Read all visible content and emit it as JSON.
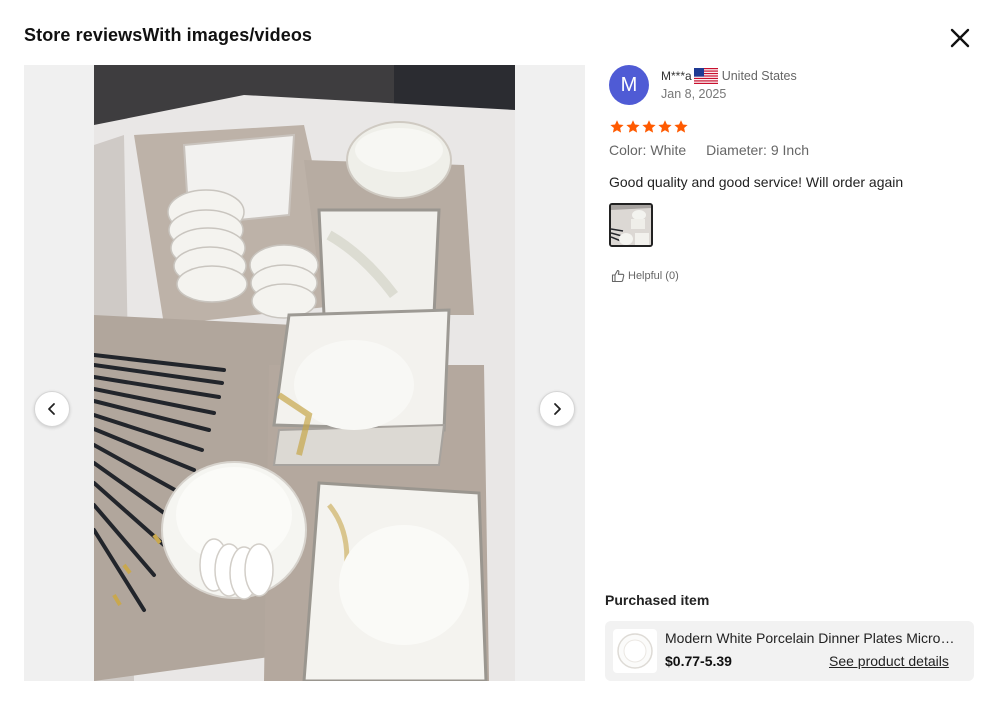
{
  "header": {
    "title": "Store reviewsWith images/videos",
    "close_icon": "close-icon"
  },
  "gallery": {
    "prev_icon": "chevron-left-icon",
    "next_icon": "chevron-right-icon",
    "photo_icon": "review-photo-dinnerware"
  },
  "review": {
    "avatar_letter": "M",
    "avatar_color": "#4f5bd5",
    "username": "M***a",
    "flag_icon": "us-flag-icon",
    "country": "United States",
    "date": "Jan 8, 2025",
    "rating": 5,
    "star_color": "#ff5a00",
    "attributes": [
      {
        "name": "Color:",
        "value": "White"
      },
      {
        "name": "Diameter:",
        "value": "9 Inch"
      }
    ],
    "text": "Good quality and good service! Will order again",
    "helpful_label": "Helpful (0)",
    "helpful_icon": "thumbs-up-icon"
  },
  "purchased": {
    "label": "Purchased item",
    "title": "Modern White Porcelain Dinner Plates Microwave Safe Dinnerware Set",
    "price": "$0.77-5.39",
    "link_label": "See product details"
  }
}
